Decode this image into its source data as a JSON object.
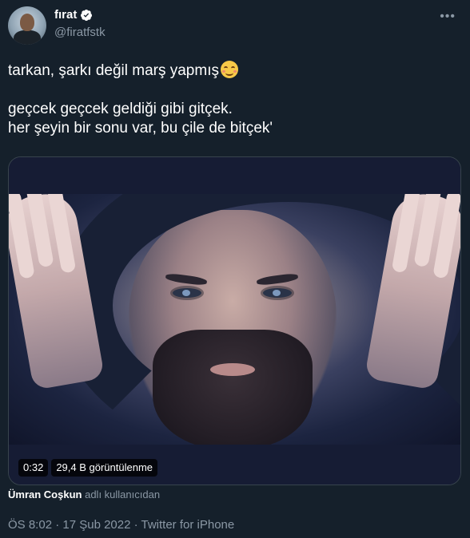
{
  "author": {
    "name": "fırat",
    "handle": "@firatfstk",
    "verified": true,
    "avatar_icon": "avatar-photo"
  },
  "more_icon": "ellipsis-icon",
  "tweet": {
    "line1": "tarkan, şarkı değil marş yapmış",
    "line1_emoji": "smiling-face-icon",
    "line2": "geçcek geçcek geldiği gibi gitçek.",
    "line3": "her şeyin bir sonu var, bu çile de bitçek'"
  },
  "media": {
    "duration": "0:32",
    "views": "29,4 B görüntülenme"
  },
  "attribution": {
    "user": "Ümran Coşkun",
    "suffix": "adlı kullanıcıdan"
  },
  "meta": {
    "line": "ÖS 8:02 · 17 Şub 2022 · Twitter for iPhone"
  },
  "colors": {
    "background": "#15202b",
    "secondary_text": "#8b98a5",
    "verified_blue": "#ffffff"
  }
}
